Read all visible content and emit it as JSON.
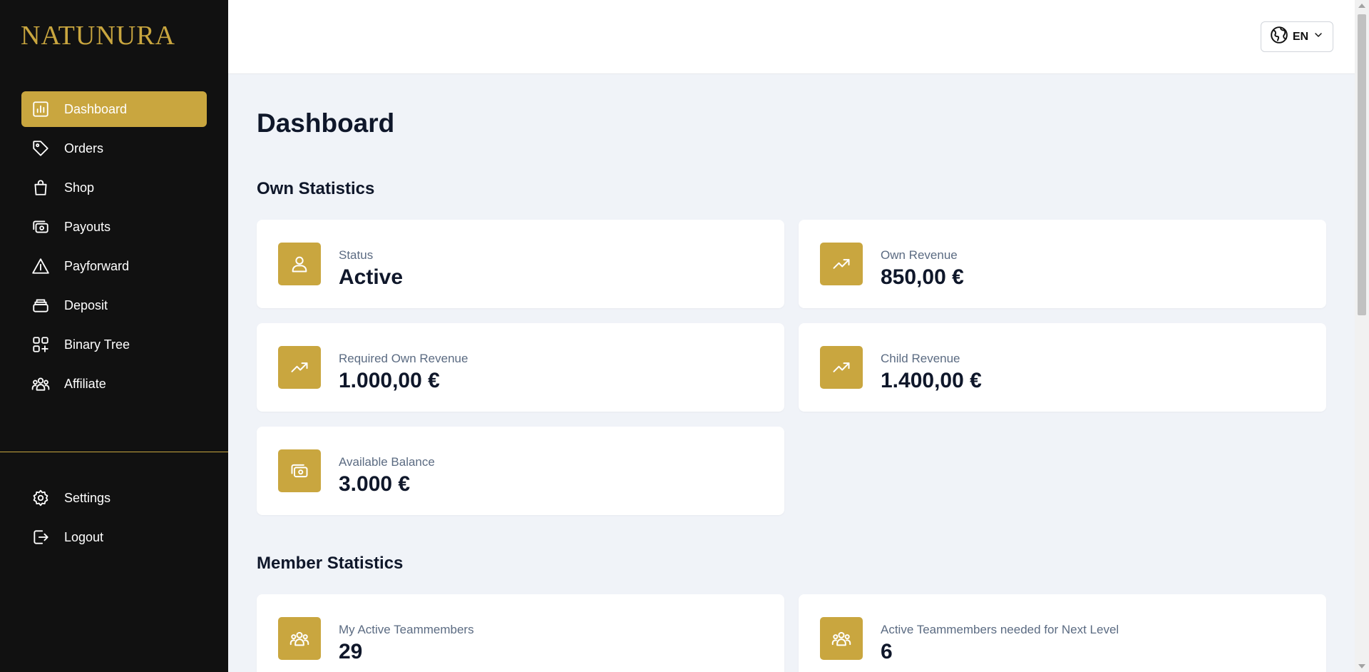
{
  "brand": {
    "logo_text": "NATUNURA",
    "accent_color": "#c9a63f"
  },
  "sidebar": {
    "items": [
      {
        "label": "Dashboard",
        "icon": "chart-icon",
        "active": true
      },
      {
        "label": "Orders",
        "icon": "tag-icon"
      },
      {
        "label": "Shop",
        "icon": "shopping-bag-icon"
      },
      {
        "label": "Payouts",
        "icon": "cash-icon"
      },
      {
        "label": "Payforward",
        "icon": "warning-triangle-icon"
      },
      {
        "label": "Deposit",
        "icon": "archive-icon"
      },
      {
        "label": "Binary Tree",
        "icon": "grid-plus-icon"
      },
      {
        "label": "Affiliate",
        "icon": "users-icon"
      }
    ],
    "bottom_items": [
      {
        "label": "Settings",
        "icon": "gear-icon"
      },
      {
        "label": "Logout",
        "icon": "logout-icon"
      }
    ]
  },
  "topbar": {
    "language": "EN"
  },
  "main": {
    "title": "Dashboard",
    "own_statistics": {
      "title": "Own Statistics",
      "cards": [
        {
          "label": "Status",
          "value": "Active",
          "icon": "user-icon"
        },
        {
          "label": "Own Revenue",
          "value": "850,00 €",
          "icon": "trending-up-icon"
        },
        {
          "label": "Required Own Revenue",
          "value": "1.000,00 €",
          "icon": "trending-up-icon"
        },
        {
          "label": "Child Revenue",
          "value": "1.400,00 €",
          "icon": "trending-up-icon"
        },
        {
          "label": "Available Balance",
          "value": "3.000 €",
          "icon": "cash-icon"
        }
      ]
    },
    "member_statistics": {
      "title": "Member Statistics",
      "cards": [
        {
          "label": "My Active Teammembers",
          "value": "29",
          "icon": "users-icon"
        },
        {
          "label": "Active Teammembers needed for Next Level",
          "value": "6",
          "icon": "users-icon"
        }
      ]
    }
  }
}
